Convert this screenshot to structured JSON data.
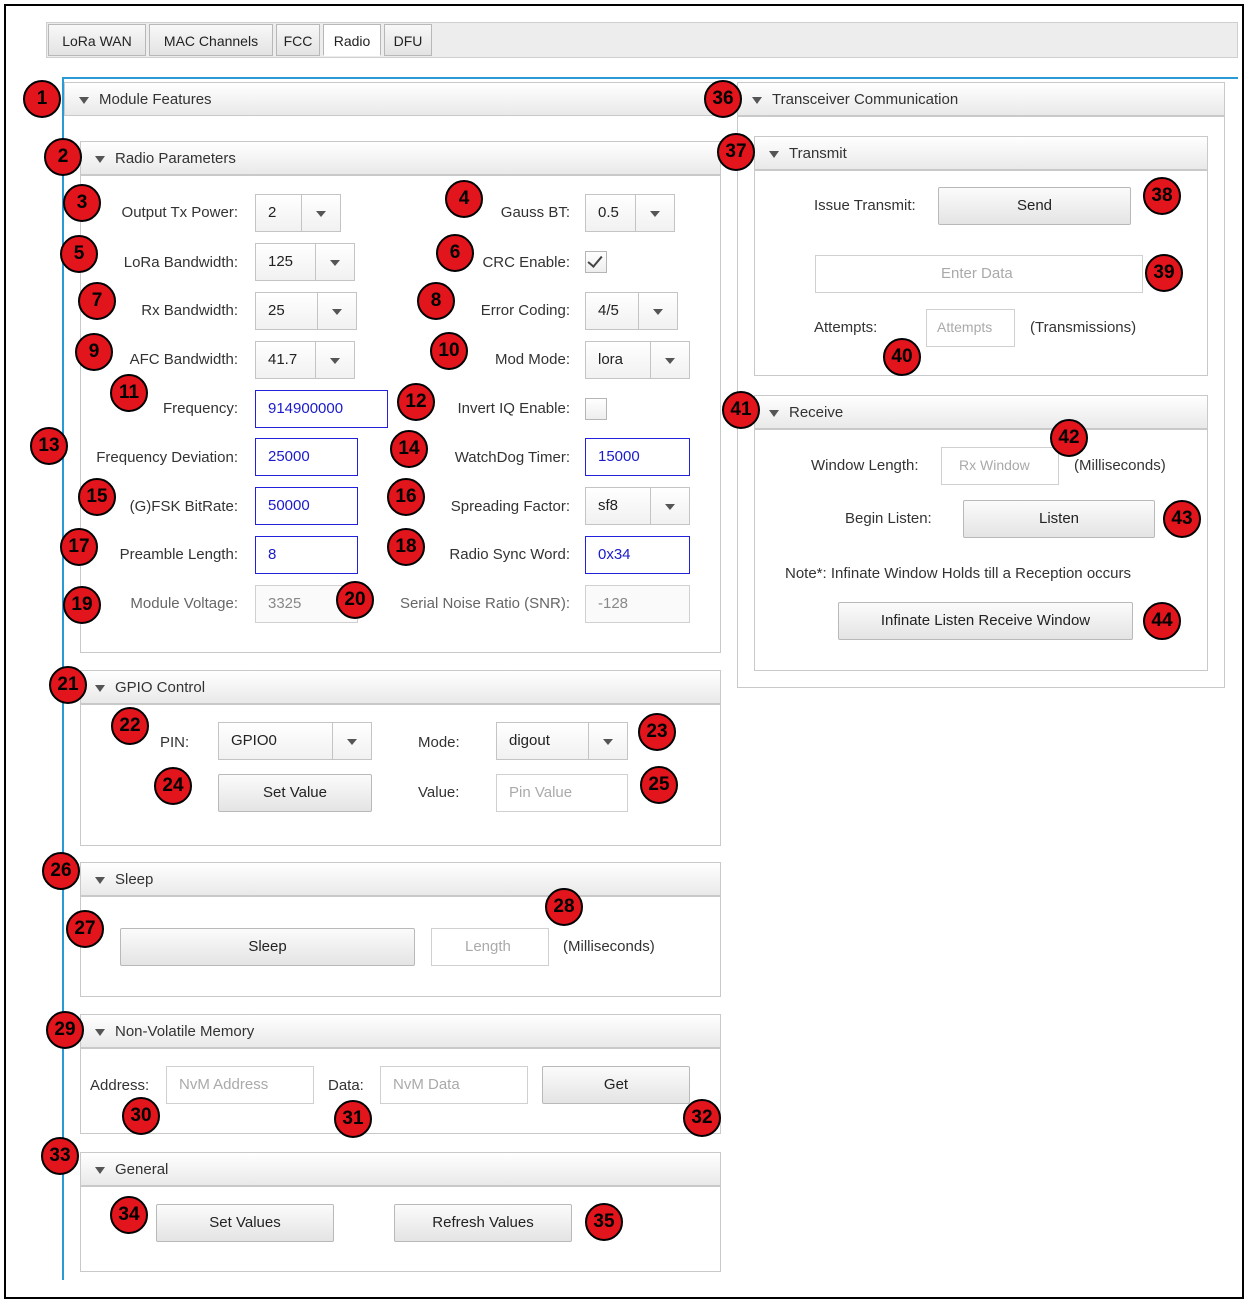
{
  "tabs": [
    "LoRa WAN",
    "MAC Channels",
    "FCC",
    "Radio",
    "DFU"
  ],
  "active_tab": "Radio",
  "sections": {
    "module_features": "Module Features",
    "radio_parameters": "Radio Parameters",
    "gpio_control": "GPIO Control",
    "sleep": "Sleep",
    "nvm": "Non-Volatile Memory",
    "general": "General",
    "transceiver": "Transceiver Communication",
    "transmit": "Transmit",
    "receive": "Receive"
  },
  "radio": {
    "output_tx_power": {
      "label": "Output Tx Power:",
      "value": "2"
    },
    "gauss_bt": {
      "label": "Gauss BT:",
      "value": "0.5"
    },
    "lora_bandwidth": {
      "label": "LoRa Bandwidth:",
      "value": "125"
    },
    "crc_enable": {
      "label": "CRC Enable:",
      "checked": true
    },
    "rx_bandwidth": {
      "label": "Rx Bandwidth:",
      "value": "25"
    },
    "error_coding": {
      "label": "Error Coding:",
      "value": "4/5"
    },
    "afc_bandwidth": {
      "label": "AFC Bandwidth:",
      "value": "41.7"
    },
    "mod_mode": {
      "label": "Mod Mode:",
      "value": "lora"
    },
    "frequency": {
      "label": "Frequency:",
      "value": "914900000"
    },
    "invert_iq": {
      "label": "Invert IQ Enable:",
      "checked": false
    },
    "freq_deviation": {
      "label": "Frequency Deviation:",
      "value": "25000"
    },
    "watchdog": {
      "label": "WatchDog Timer:",
      "value": "15000"
    },
    "fsk_bitrate": {
      "label": "(G)FSK BitRate:",
      "value": "50000"
    },
    "spreading_factor": {
      "label": "Spreading Factor:",
      "value": "sf8"
    },
    "preamble_length": {
      "label": "Preamble Length:",
      "value": "8"
    },
    "sync_word": {
      "label": "Radio Sync Word:",
      "value": "0x34"
    },
    "module_voltage": {
      "label": "Module Voltage:",
      "value": "3325"
    },
    "snr": {
      "label": "Serial Noise Ratio (SNR):",
      "value": "-128"
    }
  },
  "gpio": {
    "pin_label": "PIN:",
    "pin_value": "GPIO0",
    "mode_label": "Mode:",
    "mode_value": "digout",
    "set_value_button": "Set Value",
    "value_label": "Value:",
    "value_placeholder": "Pin Value"
  },
  "sleep": {
    "button": "Sleep",
    "length_placeholder": "Length",
    "unit": "(Milliseconds)"
  },
  "nvm": {
    "address_label": "Address:",
    "address_placeholder": "NvM Address",
    "data_label": "Data:",
    "data_placeholder": "NvM Data",
    "get_button": "Get"
  },
  "general": {
    "set_values_button": "Set Values",
    "refresh_values_button": "Refresh Values"
  },
  "transmit": {
    "issue_label": "Issue Transmit:",
    "send_button": "Send",
    "data_placeholder": "Enter Data",
    "attempts_label": "Attempts:",
    "attempts_placeholder": "Attempts",
    "attempts_unit": "(Transmissions)"
  },
  "receive": {
    "window_label": "Window Length:",
    "window_placeholder": "Rx Window",
    "window_unit": "(Milliseconds)",
    "listen_label": "Begin Listen:",
    "listen_button": "Listen",
    "note": "Note*: Infinate Window Holds till a Reception occurs",
    "infinite_button": "Infinate Listen Receive Window"
  },
  "badges": [
    "1",
    "2",
    "3",
    "4",
    "5",
    "6",
    "7",
    "8",
    "9",
    "10",
    "11",
    "12",
    "13",
    "14",
    "15",
    "16",
    "17",
    "18",
    "19",
    "20",
    "21",
    "22",
    "23",
    "24",
    "25",
    "26",
    "27",
    "28",
    "29",
    "30",
    "31",
    "32",
    "33",
    "34",
    "35",
    "36",
    "37",
    "38",
    "39",
    "40",
    "41",
    "42",
    "43",
    "44"
  ],
  "colors": {
    "badge": "#e2141c",
    "accent_blue": "#2a9ad6",
    "input_border_blue": "#2222dd"
  }
}
